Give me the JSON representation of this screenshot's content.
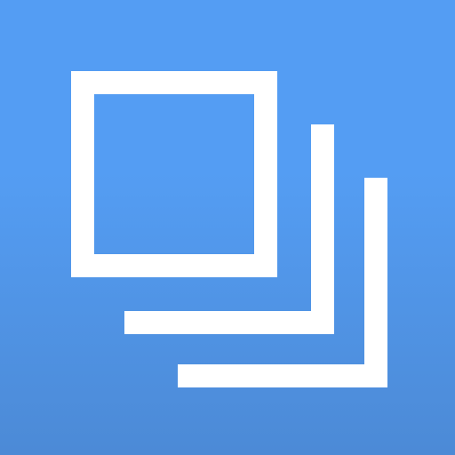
{
  "icon": {
    "name": "stacked-squares-icon",
    "background_top": "#549df3",
    "background_bottom": "#4c8ad6",
    "foreground": "#ffffff"
  }
}
